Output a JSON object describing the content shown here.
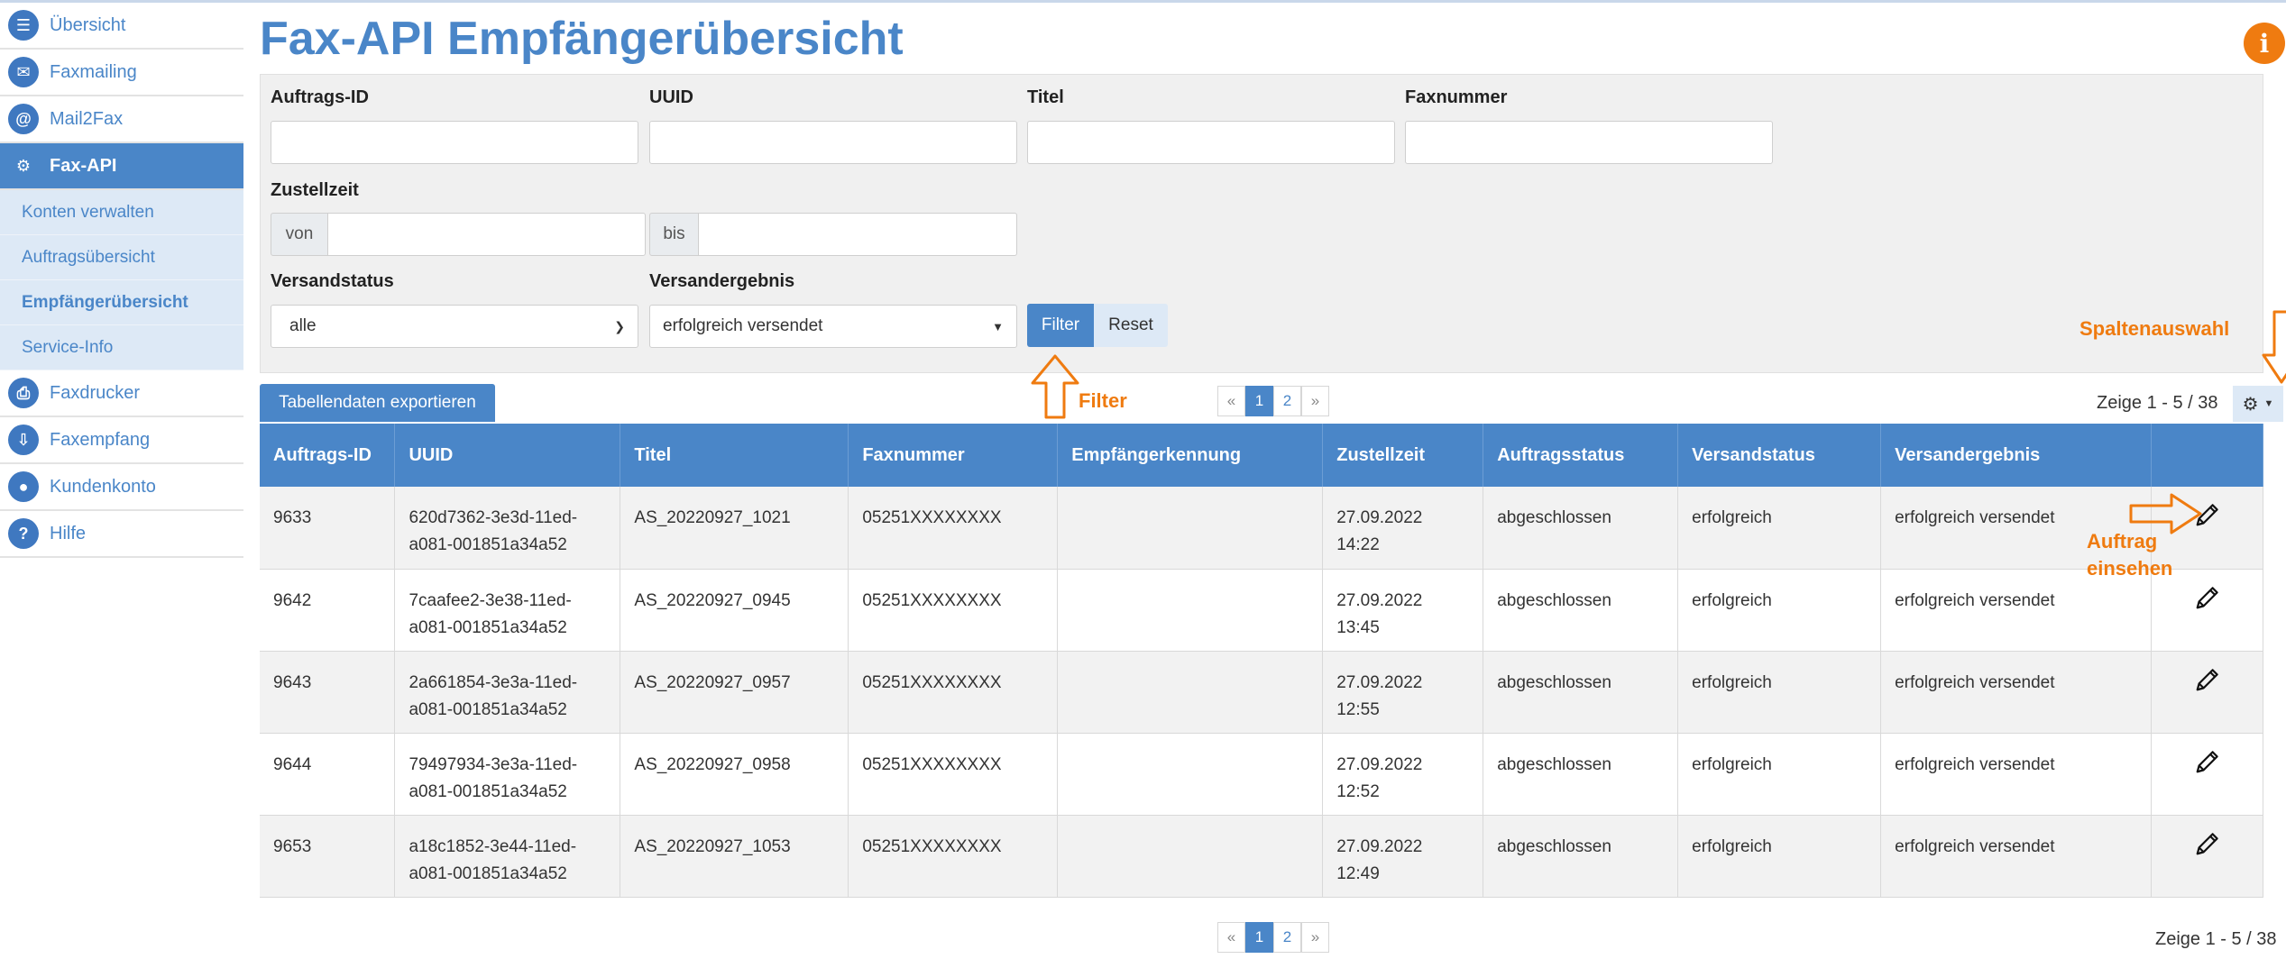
{
  "sidebar": {
    "items": [
      {
        "label": "Übersicht",
        "icon": "overview-icon"
      },
      {
        "label": "Faxmailing",
        "icon": "faxmailing-icon"
      },
      {
        "label": "Mail2Fax",
        "icon": "mail2fax-icon"
      },
      {
        "label": "Fax-API",
        "icon": "fax-api-icon"
      },
      {
        "label": "Faxdrucker",
        "icon": "faxprinter-icon"
      },
      {
        "label": "Faxempfang",
        "icon": "fax-receive-icon"
      },
      {
        "label": "Kundenkonto",
        "icon": "account-icon"
      },
      {
        "label": "Hilfe",
        "icon": "help-icon"
      }
    ],
    "subitems": [
      "Konten verwalten",
      "Auftragsübersicht",
      "Empfängerübersicht",
      "Service-Info"
    ]
  },
  "page": {
    "title": "Fax-API Empfängerübersicht",
    "info": "i"
  },
  "filter": {
    "order_id_label": "Auftrags-ID",
    "uuid_label": "UUID",
    "title_label": "Titel",
    "faxnumber_label": "Faxnummer",
    "delivery_label": "Zustellzeit",
    "from_label": "von",
    "to_label": "bis",
    "status_label": "Versandstatus",
    "status_value": "alle",
    "result_label": "Versandergebnis",
    "result_value": "erfolgreich versendet",
    "filter_button": "Filter",
    "reset_button": "Reset"
  },
  "toolbar": {
    "export_button": "Tabellendaten exportieren",
    "pages": [
      "«",
      "1",
      "2",
      "»"
    ],
    "count_top": "Zeige 1 - 5 / 38",
    "count_bottom": "Zeige 1 - 5 / 38"
  },
  "table": {
    "columns": [
      "Auftrags-ID",
      "UUID",
      "Titel",
      "Faxnummer",
      "Empfängerkennung",
      "Zustellzeit",
      "Auftragsstatus",
      "Versandstatus",
      "Versandergebnis",
      ""
    ],
    "rows": [
      {
        "id": "9633",
        "uuid1": "620d7362-3e3d-11ed-",
        "uuid2": "a081-001851a34a52",
        "title": "AS_20220927_1021",
        "fax": "05251XXXXXXXX",
        "recipient": "",
        "date": "27.09.2022",
        "time": "14:22",
        "order_status": "abgeschlossen",
        "send_status": "erfolgreich",
        "result": "erfolgreich versendet"
      },
      {
        "id": "9642",
        "uuid1": "7caafee2-3e38-11ed-",
        "uuid2": "a081-001851a34a52",
        "title": "AS_20220927_0945",
        "fax": "05251XXXXXXXX",
        "recipient": "",
        "date": "27.09.2022",
        "time": "13:45",
        "order_status": "abgeschlossen",
        "send_status": "erfolgreich",
        "result": "erfolgreich versendet"
      },
      {
        "id": "9643",
        "uuid1": "2a661854-3e3a-11ed-",
        "uuid2": "a081-001851a34a52",
        "title": "AS_20220927_0957",
        "fax": "05251XXXXXXXX",
        "recipient": "",
        "date": "27.09.2022",
        "time": "12:55",
        "order_status": "abgeschlossen",
        "send_status": "erfolgreich",
        "result": "erfolgreich versendet"
      },
      {
        "id": "9644",
        "uuid1": "79497934-3e3a-11ed-",
        "uuid2": "a081-001851a34a52",
        "title": "AS_20220927_0958",
        "fax": "05251XXXXXXXX",
        "recipient": "",
        "date": "27.09.2022",
        "time": "12:52",
        "order_status": "abgeschlossen",
        "send_status": "erfolgreich",
        "result": "erfolgreich versendet"
      },
      {
        "id": "9653",
        "uuid1": "a18c1852-3e44-11ed-",
        "uuid2": "a081-001851a34a52",
        "title": "AS_20220927_1053",
        "fax": "05251XXXXXXXX",
        "recipient": "",
        "date": "27.09.2022",
        "time": "12:49",
        "order_status": "abgeschlossen",
        "send_status": "erfolgreich",
        "result": "erfolgreich versendet"
      }
    ]
  },
  "annotations": {
    "column_select": "Spaltenauswahl",
    "filter": "Filter",
    "view_order_1": "Auftrag",
    "view_order_2": "einsehen"
  },
  "colors": {
    "primary": "#4a86c8",
    "accent": "#ef7b10",
    "success": "#3aa53a"
  }
}
